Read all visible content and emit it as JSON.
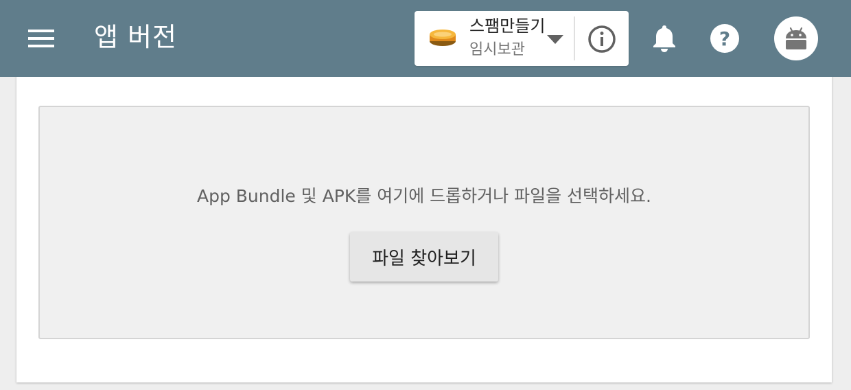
{
  "header": {
    "title": "앱 버전",
    "background_color": "#607d8b",
    "menu_icon": "hamburger-menu-icon",
    "app_selector": {
      "app_name": "스팸만들기",
      "app_status": "임시보관",
      "app_icon": "spam-can-icon",
      "dropdown_icon": "caret-down-icon",
      "info_icon": "info-circle-icon"
    },
    "notification_icon": "bell-icon",
    "help_icon": "help-circle-icon",
    "avatar_icon": "android-robot-icon"
  },
  "upload": {
    "instruction": "App Bundle 및 APK를 여기에 드롭하거나 파일을 선택하세요.",
    "browse_label": "파일 찾아보기"
  }
}
